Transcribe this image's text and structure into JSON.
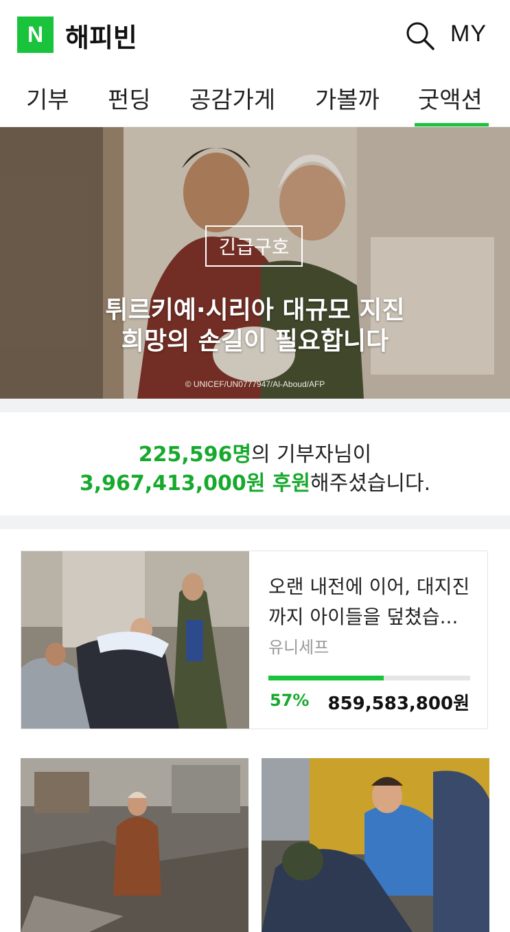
{
  "header": {
    "logo_letter": "N",
    "app_name": "해피빈",
    "my_label": "MY"
  },
  "tabs": [
    {
      "label": "기부"
    },
    {
      "label": "펀딩"
    },
    {
      "label": "공감가게"
    },
    {
      "label": "가볼까"
    },
    {
      "label": "굿액션",
      "active": true
    }
  ],
  "hero": {
    "badge": "긴급구호",
    "headline_line1": "튀르키예·시리아 대규모 지진",
    "headline_line2": "희망의 손길이 필요합니다",
    "credit": "© UNICEF/UN0777947/Al-Aboud/AFP"
  },
  "stats": {
    "donor_count": "225,596명",
    "donor_suffix": "의 기부자님이",
    "amount": "3,967,413,000원 후원",
    "amount_suffix": "해주셨습니다."
  },
  "campaign": {
    "title": "오랜 내전에 이어, 대지진 까지 아이들을 덮쳤습...",
    "organization": "유니세프",
    "percent_label": "57%",
    "progress_fraction": 0.57,
    "amount": "859,583,800원"
  },
  "colors": {
    "brand_green": "#19c33c",
    "text_green": "#17a92d"
  }
}
